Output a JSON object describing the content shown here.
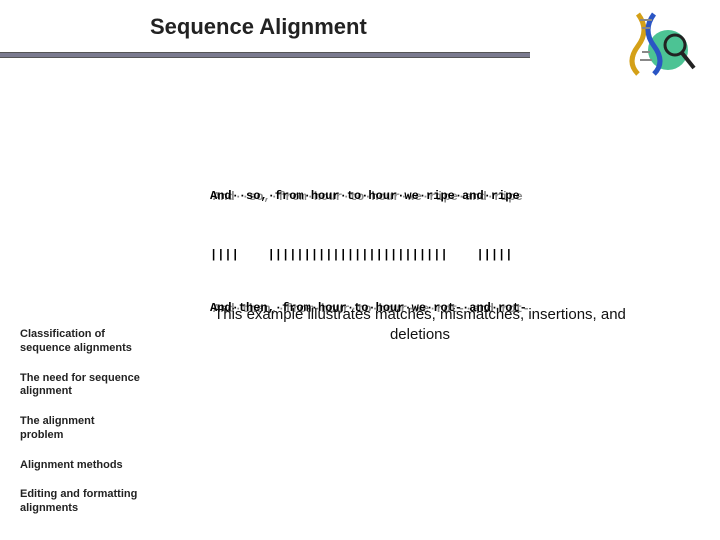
{
  "header": {
    "title": "Sequence Alignment"
  },
  "alignment": {
    "seq1_main": "And··so,·from·hour·to·hour·we·ripe·and·ripe",
    "seq1_ghost": "And··so,·from·hour·to·hour·we·ripe·and·ripe",
    "match_line": "||||    |||||||||||||||||||||||||    |||||",
    "seq2_main": "And·then,·from·hour·to·hour·we·rot-·and·rot-",
    "seq2_ghost": "And·then,·from·hour·to·hour·we·rot-·and·rot-"
  },
  "caption": "This example illustrates matches, mismatches, insertions, and deletions",
  "sidebar": {
    "items": [
      "Classification of sequence alignments",
      "The need for sequence alignment",
      "The alignment problem",
      "Alignment methods",
      "Editing and formatting alignments"
    ]
  },
  "icons": {
    "logo": "dna-helix-magnifier-icon"
  }
}
